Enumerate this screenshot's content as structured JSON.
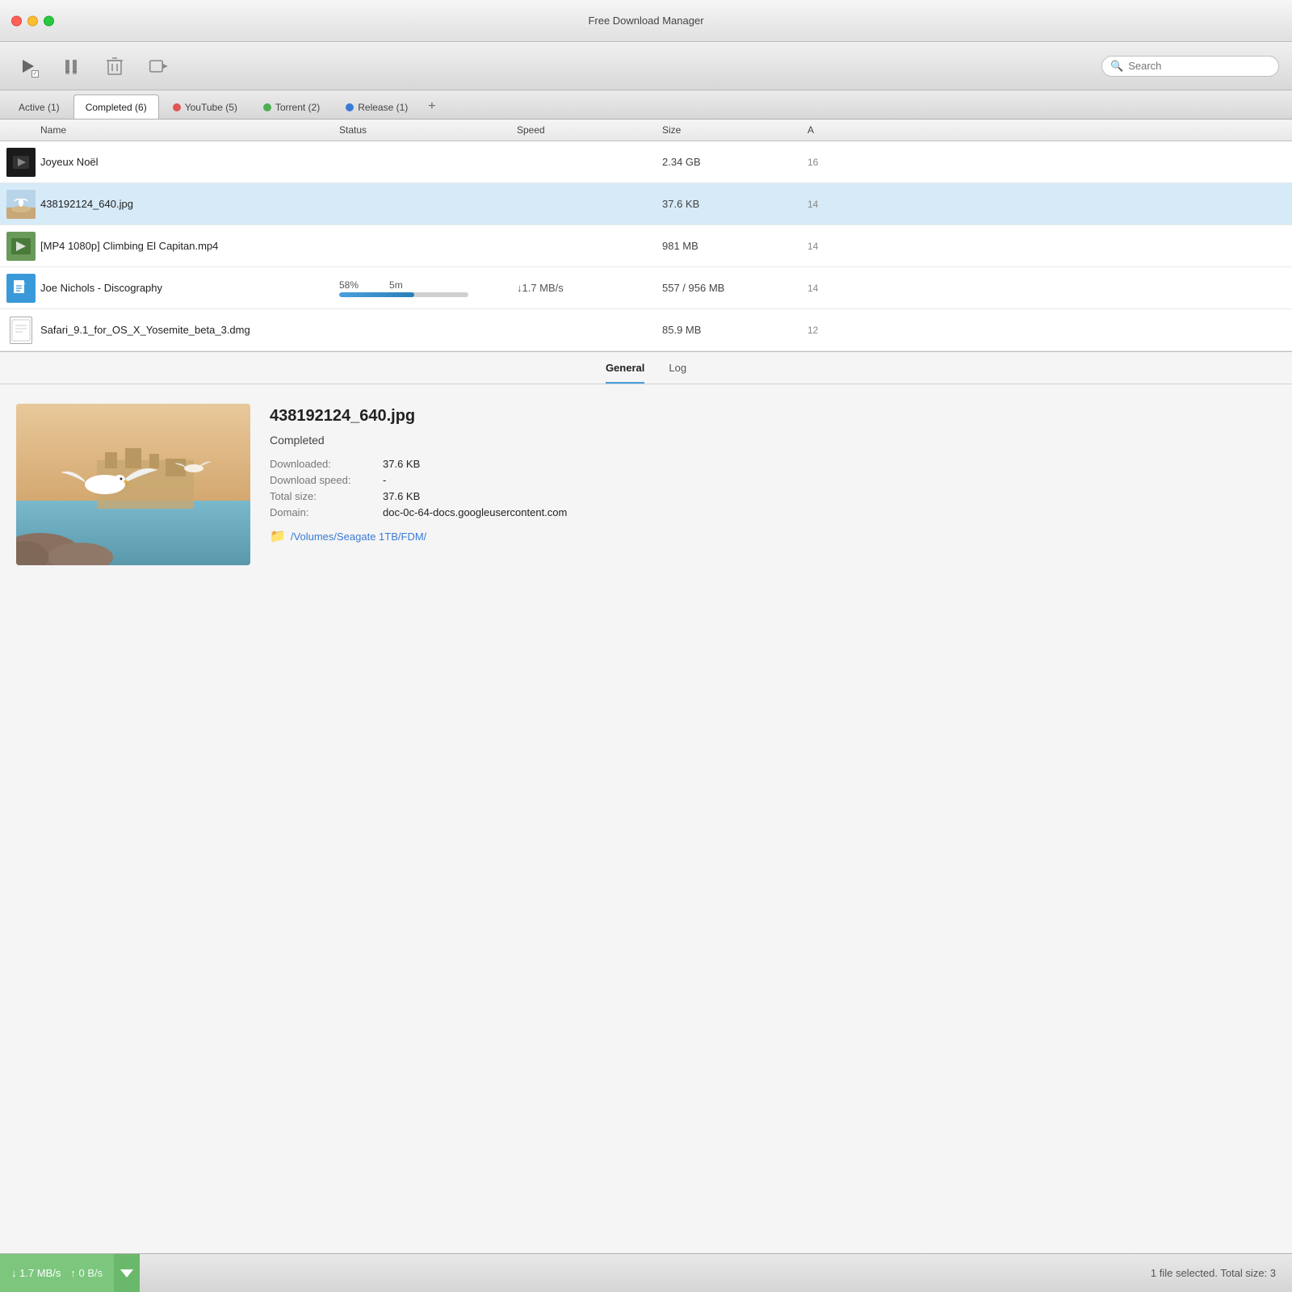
{
  "app": {
    "title": "Free Download Manager"
  },
  "toolbar": {
    "play_label": "▶",
    "pause_label": "⏸",
    "delete_label": "🗑",
    "move_label": "➡",
    "search_placeholder": "Search"
  },
  "tabs": [
    {
      "id": "active",
      "label": "Active (1)",
      "dot_color": null,
      "active": false
    },
    {
      "id": "completed",
      "label": "Completed (6)",
      "dot_color": null,
      "active": true
    },
    {
      "id": "youtube",
      "label": "YouTube (5)",
      "dot_color": "#e05555",
      "active": false
    },
    {
      "id": "torrent",
      "label": "Torrent (2)",
      "dot_color": "#4caf50",
      "active": false
    },
    {
      "id": "release",
      "label": "Release (1)",
      "dot_color": "#3a7bd5",
      "active": false
    }
  ],
  "columns": {
    "name": "Name",
    "status": "Status",
    "speed": "Speed",
    "size": "Size",
    "added": "A"
  },
  "rows": [
    {
      "id": 1,
      "icon_type": "image",
      "icon_color": "#111",
      "name": "Joyeux Noël",
      "status": "",
      "speed": "",
      "size": "2.34 GB",
      "added": "16",
      "selected": false
    },
    {
      "id": 2,
      "icon_type": "image",
      "icon_color": "#5b9bd5",
      "name": "438192124_640.jpg",
      "status": "",
      "speed": "",
      "size": "37.6 KB",
      "added": "14",
      "selected": true
    },
    {
      "id": 3,
      "icon_type": "video",
      "icon_color": "#8BC34A",
      "name": "[MP4 1080p] Climbing El Capitan.mp4",
      "status": "",
      "speed": "",
      "size": "981 MB",
      "added": "14",
      "selected": false
    },
    {
      "id": 4,
      "icon_type": "torrent",
      "icon_color": "#3a7bd5",
      "name": "Joe Nichols - Discography",
      "status_pct": "58%",
      "status_time": "5m",
      "progress": 58,
      "speed": "↓1.7 MB/s",
      "size": "557 / 956 MB",
      "added": "14",
      "selected": false
    },
    {
      "id": 5,
      "icon_type": "dmg",
      "icon_color": "#aaa",
      "name": "Safari_9.1_for_OS_X_Yosemite_beta_3.dmg",
      "status": "",
      "speed": "",
      "size": "85.9 MB",
      "added": "12",
      "selected": false
    }
  ],
  "detail": {
    "tabs": [
      "General",
      "Log"
    ],
    "active_tab": "General",
    "filename": "438192124_640.jpg",
    "status": "Completed",
    "downloaded_label": "Downloaded:",
    "downloaded_value": "37.6 KB",
    "download_speed_label": "Download speed:",
    "download_speed_value": "-",
    "total_size_label": "Total size:",
    "total_size_value": "37.6 KB",
    "domain_label": "Domain:",
    "domain_value": "doc-0c-64-docs.googleusercontent.com",
    "path": "/Volumes/Seagate 1TB/FDM/"
  },
  "statusbar": {
    "down_speed": "1.7 MB/s",
    "up_label": "↑",
    "up_speed": "0 B/s",
    "down_label": "↓",
    "message": "1 file selected. Total size: 3"
  }
}
